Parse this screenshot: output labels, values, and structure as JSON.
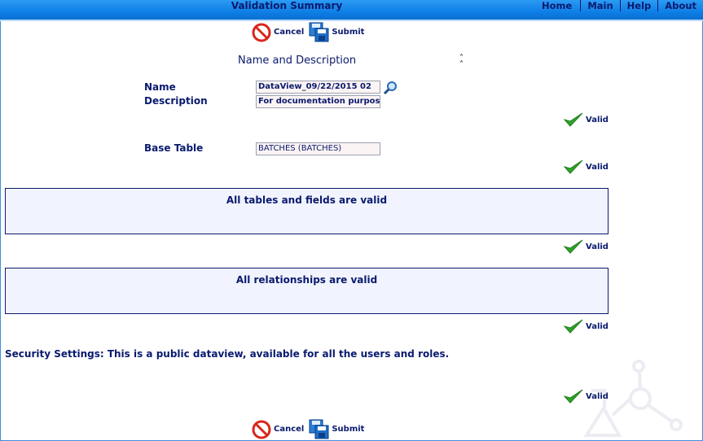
{
  "header": {
    "title": "Validation Summary"
  },
  "nav": {
    "home": "Home",
    "main": "Main",
    "help": "Help",
    "about": "About"
  },
  "actions": {
    "cancel_label": "Cancel",
    "submit_label": "Submit"
  },
  "section": {
    "title": "Name and Description"
  },
  "fields": {
    "name_label": "Name",
    "name_value": "DataView_09/22/2015 02",
    "description_label": "Description",
    "description_value": "For documentation purpos",
    "base_table_label": "Base Table",
    "base_table_value": "BATCHES (BATCHES)"
  },
  "validation": {
    "valid_label": "Valid"
  },
  "panels": {
    "tables": "All tables and fields are valid",
    "relationships": "All relationships are valid"
  },
  "security": {
    "text": "Security Settings: This is a public dataview, available for all the users and roles."
  },
  "colors": {
    "header_blue": "#0e7fe6",
    "navy_text": "#0a1a6e",
    "panel_bg": "#f1f4fe",
    "check_green": "#2fa52a",
    "cancel_red": "#d9261c"
  },
  "icons": [
    "cancel-icon",
    "submit-icon",
    "search-icon",
    "collapse-icon",
    "checkmark-icon",
    "lab-watermark-icon"
  ]
}
